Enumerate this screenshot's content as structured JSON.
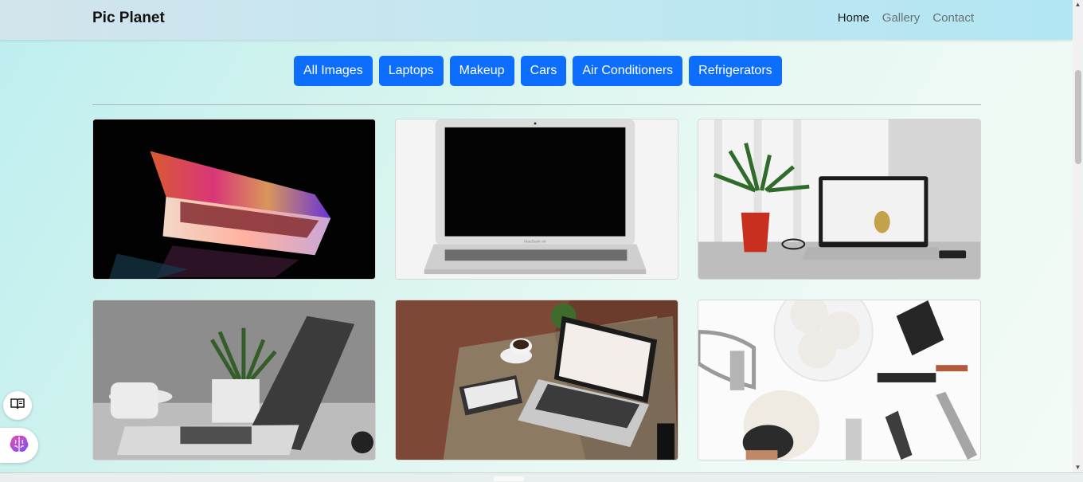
{
  "navbar": {
    "brand": "Pic Planet",
    "links": [
      {
        "label": "Home",
        "active": true
      },
      {
        "label": "Gallery",
        "active": false
      },
      {
        "label": "Contact",
        "active": false
      }
    ]
  },
  "filters": [
    "All Images",
    "Laptops",
    "Makeup",
    "Cars",
    "Air Conditioners",
    "Refrigerators"
  ],
  "gallery": [
    {
      "subject": "laptop-neon-keyboard-dark"
    },
    {
      "subject": "laptop-front-white"
    },
    {
      "subject": "laptop-desk-plant"
    },
    {
      "subject": "laptop-side-mug"
    },
    {
      "subject": "laptop-wooden-table"
    },
    {
      "subject": "makeup-brushes"
    }
  ],
  "colors": {
    "accent": "#0d6efd",
    "nav_active": "#1a1a1a",
    "nav_inactive": "#6b7073"
  }
}
